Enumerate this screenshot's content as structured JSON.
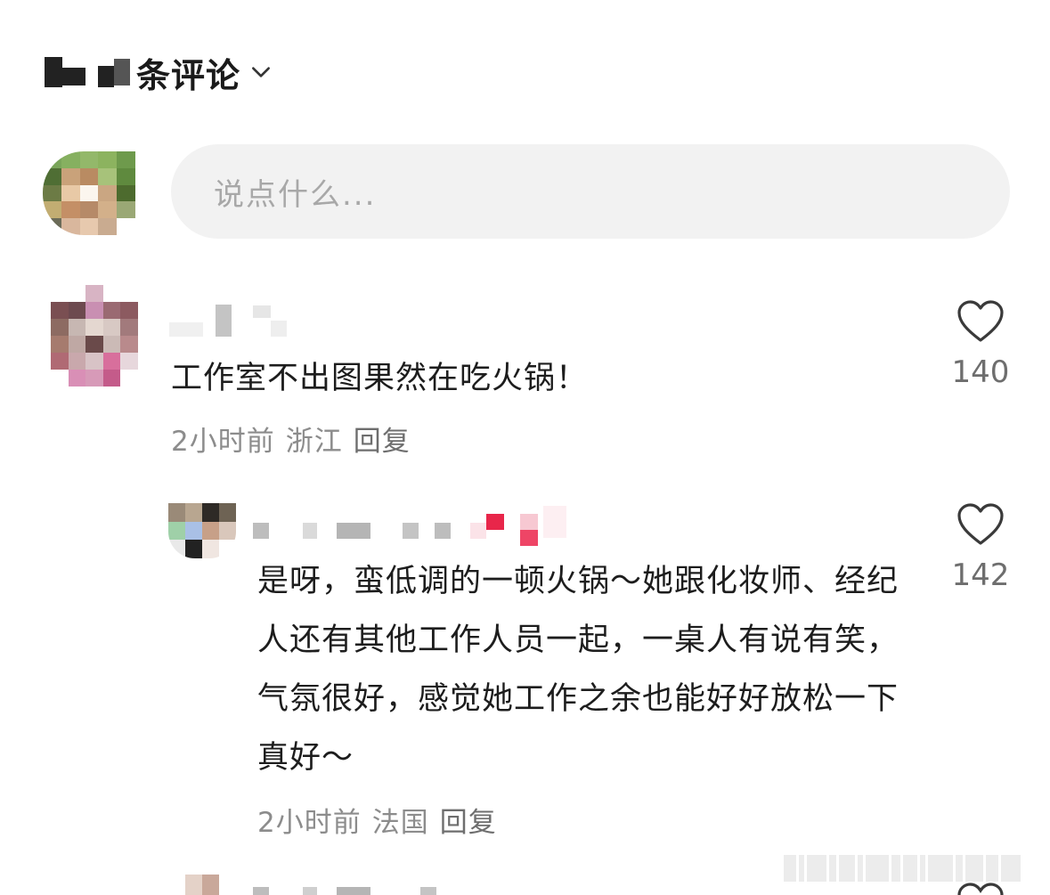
{
  "header": {
    "title": "条评论",
    "chevron_icon": "chevron-down-icon"
  },
  "compose": {
    "placeholder": "说点什么..."
  },
  "comments": [
    {
      "text": "工作室不出图果然在吃火锅！",
      "time": "2小时前",
      "location": "浙江",
      "reply_label": "回复",
      "likes": "140",
      "like_icon": "heart-outline-icon"
    },
    {
      "text": "是呀，蛮低调的一顿火锅～她跟化妆师、经纪人还有其他工作人员一起，一桌人有说有笑，气氛很好，感觉她工作之余也能好好放松一下真好～",
      "time": "2小时前",
      "location": "法国",
      "reply_label": "回复",
      "likes": "142",
      "like_icon": "heart-outline-icon"
    }
  ]
}
